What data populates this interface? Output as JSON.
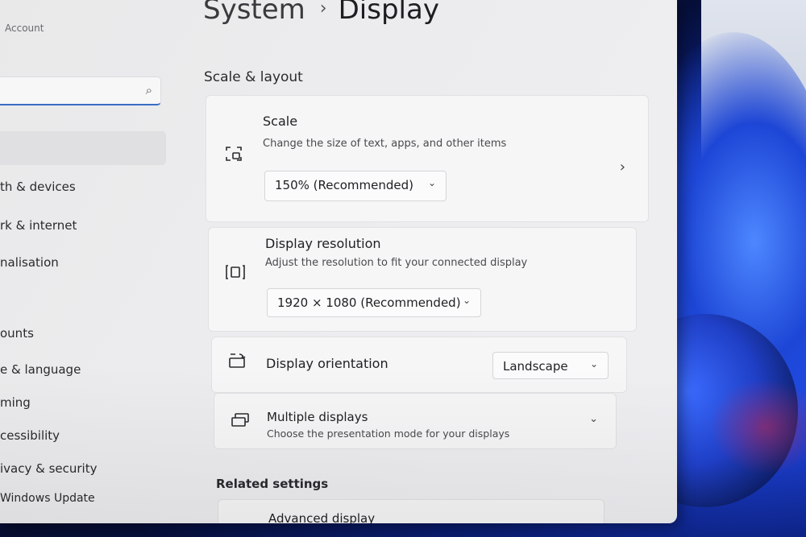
{
  "sidebar": {
    "account_label": "Account",
    "search": {
      "value": "",
      "icon": "search-icon"
    },
    "items": [
      {
        "label": "th & devices"
      },
      {
        "label": "rk & internet"
      },
      {
        "label": "nalisation"
      },
      {
        "label": "ounts"
      },
      {
        "label": "e & language"
      },
      {
        "label": "ming"
      },
      {
        "label": "cessibility"
      },
      {
        "label": "ivacy & security"
      },
      {
        "label": "Windows Update"
      }
    ]
  },
  "header": {
    "parent": "System",
    "separator": "›",
    "title": "Display"
  },
  "section": {
    "title": "Scale & layout"
  },
  "scale": {
    "title": "Scale",
    "subtitle": "Change the size of text, apps, and other items",
    "value": "150% (Recommended)"
  },
  "resolution": {
    "title": "Display resolution",
    "subtitle": "Adjust the resolution to fit your connected display",
    "value": "1920 × 1080 (Recommended)"
  },
  "orientation": {
    "title": "Display orientation",
    "value": "Landscape"
  },
  "multiple": {
    "title": "Multiple displays",
    "subtitle": "Choose the presentation mode for your displays"
  },
  "related": {
    "title": "Related settings",
    "advanced": "Advanced display"
  },
  "colors": {
    "accent": "#3a6cc4",
    "window_bg": "#ececee",
    "card_bg": "#f6f6f7"
  }
}
